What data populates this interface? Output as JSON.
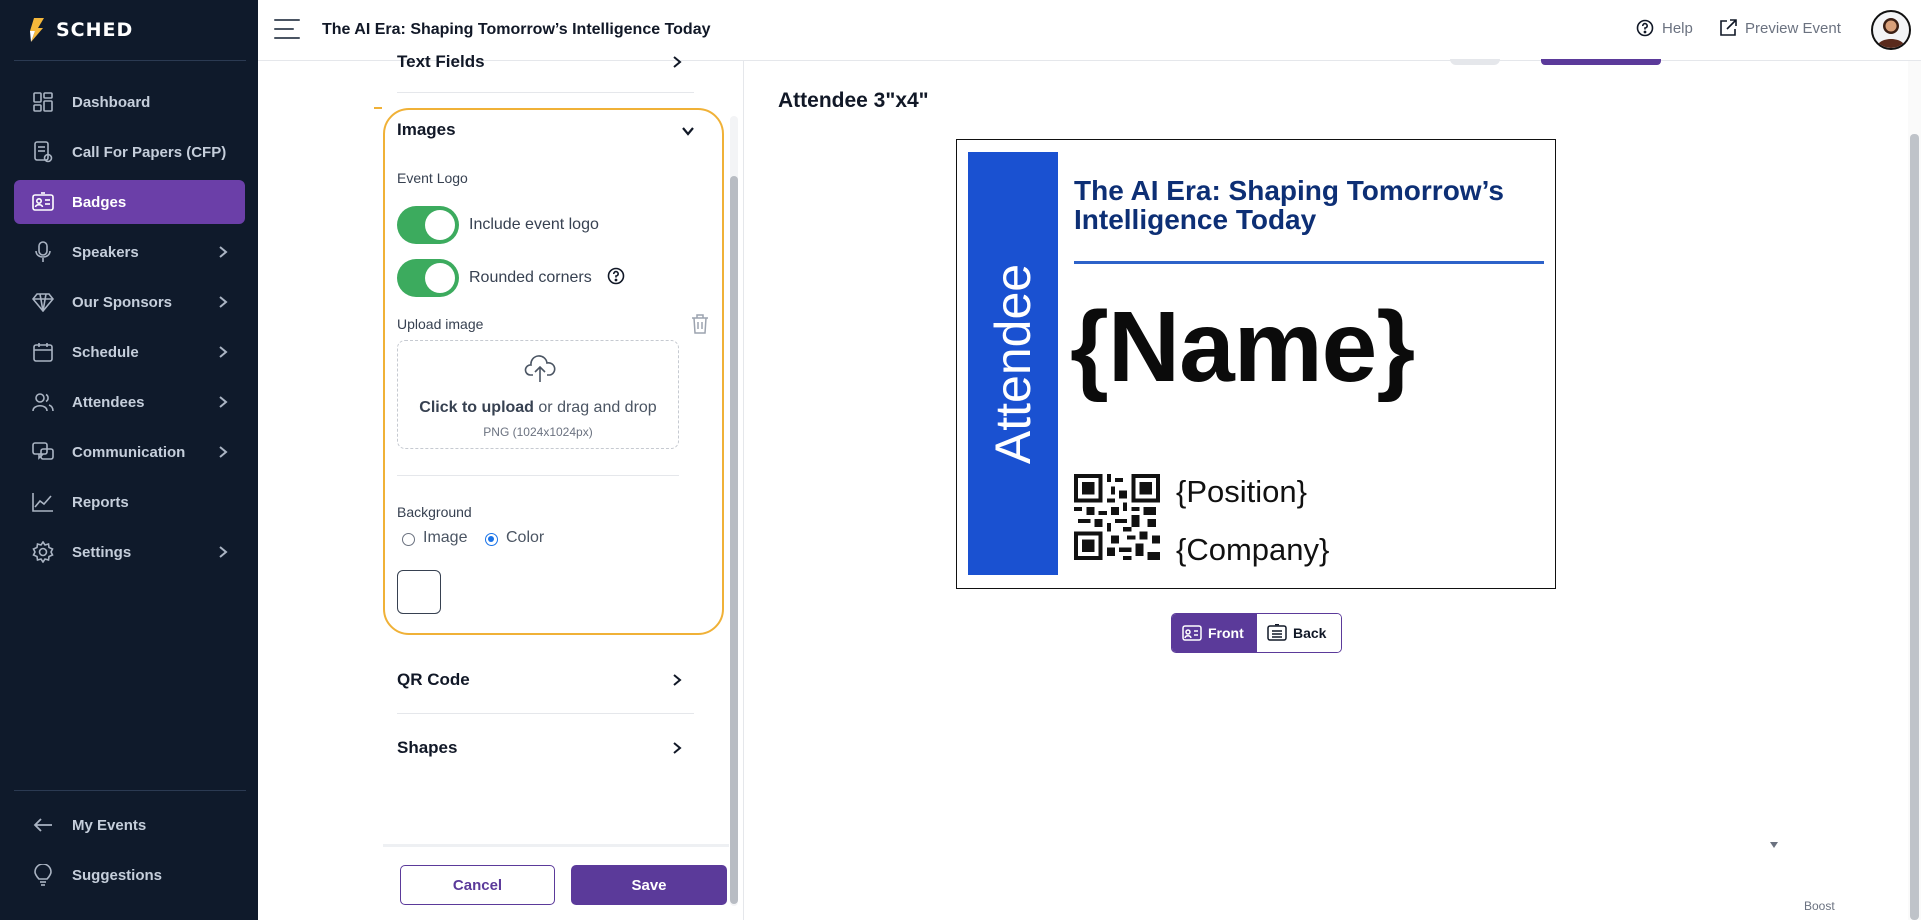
{
  "app": {
    "logo_text": "SCHED"
  },
  "topbar": {
    "event_title": "The AI Era: Shaping Tomorrow’s Intelligence Today",
    "help_label": "Help",
    "preview_label": "Preview Event"
  },
  "sidebar": {
    "items": [
      {
        "label": "Dashboard",
        "icon": "dashboard-icon",
        "has_chevron": false,
        "active": false
      },
      {
        "label": "Call For Papers (CFP)",
        "icon": "cfp-icon",
        "has_chevron": false,
        "active": false
      },
      {
        "label": "Badges",
        "icon": "badge-icon",
        "has_chevron": false,
        "active": true
      },
      {
        "label": "Speakers",
        "icon": "microphone-icon",
        "has_chevron": true,
        "active": false
      },
      {
        "label": "Our Sponsors",
        "icon": "diamond-icon",
        "has_chevron": true,
        "active": false
      },
      {
        "label": "Schedule",
        "icon": "calendar-icon",
        "has_chevron": true,
        "active": false
      },
      {
        "label": "Attendees",
        "icon": "people-icon",
        "has_chevron": true,
        "active": false
      },
      {
        "label": "Communication",
        "icon": "chat-icon",
        "has_chevron": true,
        "active": false
      },
      {
        "label": "Reports",
        "icon": "chart-icon",
        "has_chevron": false,
        "active": false
      },
      {
        "label": "Settings",
        "icon": "gear-icon",
        "has_chevron": true,
        "active": false
      }
    ],
    "bottom": [
      {
        "label": "My Events",
        "icon": "arrow-left-icon"
      },
      {
        "label": "Suggestions",
        "icon": "lightbulb-icon"
      }
    ]
  },
  "editor": {
    "text_fields_label": "Text Fields",
    "images": {
      "title": "Images",
      "event_logo_label": "Event Logo",
      "include_logo_label": "Include event logo",
      "include_logo_on": true,
      "rounded_corners_label": "Rounded corners",
      "rounded_corners_on": true,
      "upload_label": "Upload image",
      "upload_click": "Click to upload",
      "upload_rest": " or drag and drop",
      "upload_hint": "PNG (1024x1024px)",
      "background_label": "Background",
      "bg_option_image": "Image",
      "bg_option_color": "Color",
      "bg_selected": "Color",
      "bg_color": "#ffffff"
    },
    "qr_code_label": "QR Code",
    "shapes_label": "Shapes",
    "cancel_label": "Cancel",
    "save_label": "Save"
  },
  "preview": {
    "title": "Attendee 3\"x4\"",
    "band_text": "Attendee",
    "band_color": "#1a51d1",
    "badge_title": "The AI Era: Shaping Tomorrow’s Intelligence Today",
    "name_placeholder": "{Name}",
    "position_placeholder": "{Position}",
    "company_placeholder": "{Company}",
    "front_label": "Front",
    "back_label": "Back",
    "active_side": "Front"
  },
  "footer": {
    "boost_label": "Boost"
  },
  "colors": {
    "accent": "#5b3a9a",
    "sidebar_bg": "#0f1a2b",
    "highlight": "#f0b137",
    "toggle_on": "#3cab5e"
  }
}
